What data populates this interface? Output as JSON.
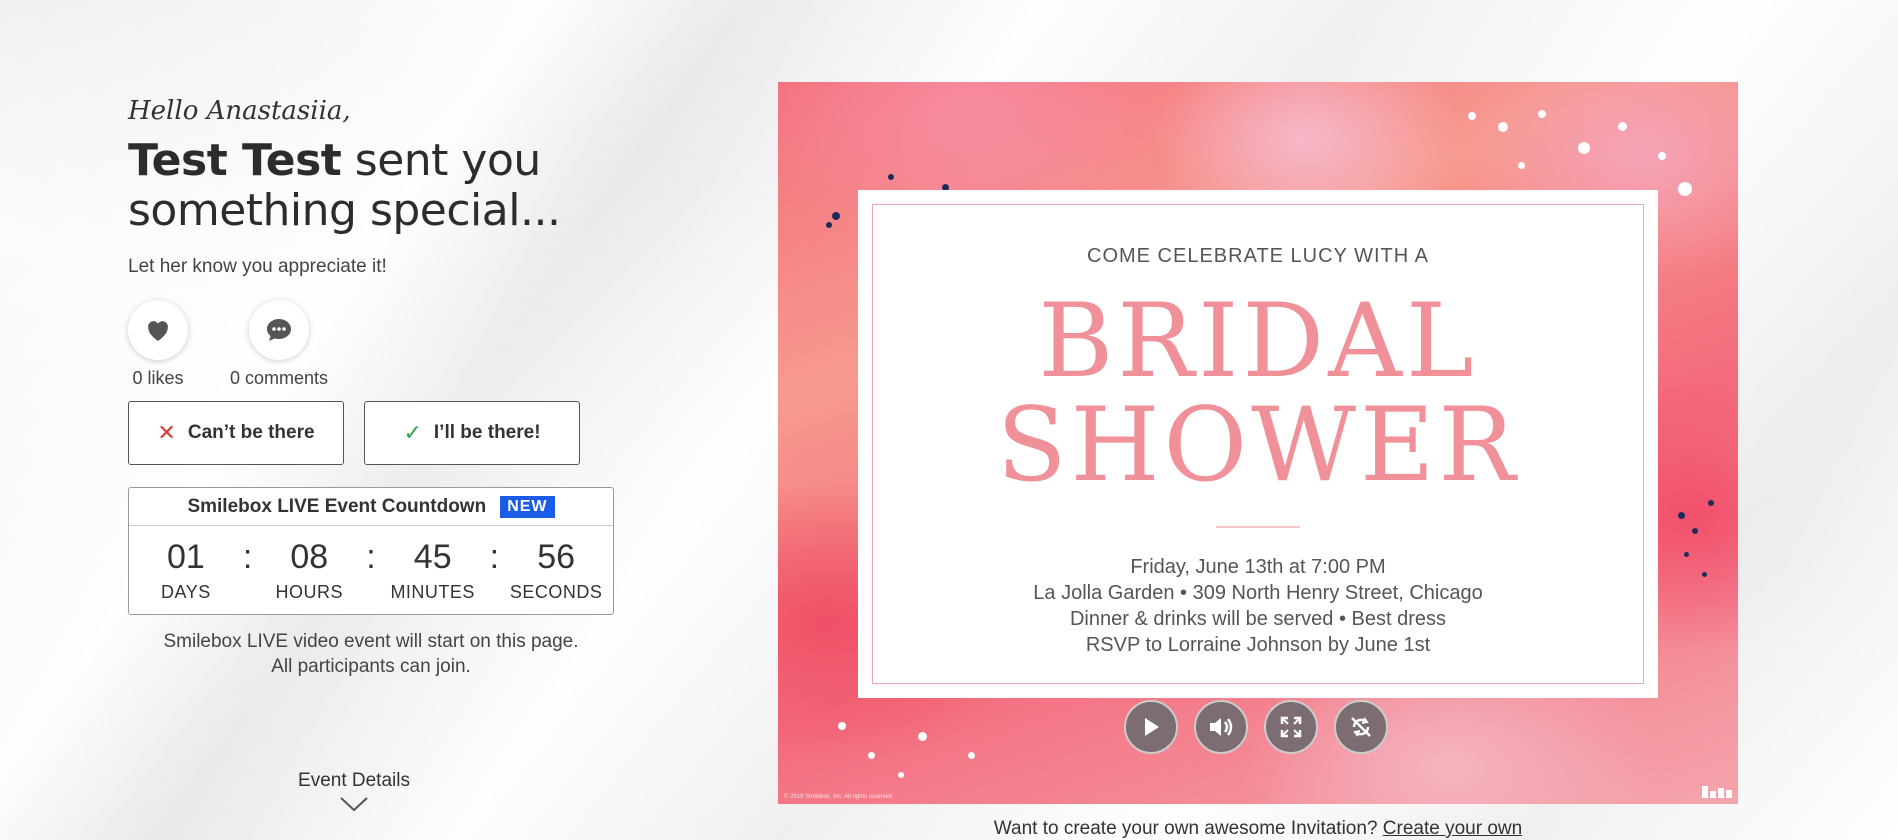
{
  "greeting": "Hello Anastasiia,",
  "headline": {
    "sender": "Test Test",
    "rest_line1": " sent you",
    "line2": "something special..."
  },
  "subline": "Let her know you appreciate it!",
  "reactions": {
    "likes_label": "0 likes",
    "comments_label": "0 comments"
  },
  "rsvp": {
    "decline_label": "Can’t be there",
    "accept_label": "I’ll be there!"
  },
  "countdown": {
    "title": "Smilebox LIVE Event Countdown",
    "badge": "NEW",
    "units": [
      {
        "value": "01",
        "label": "DAYS"
      },
      {
        "value": "08",
        "label": "HOURS"
      },
      {
        "value": "45",
        "label": "MINUTES"
      },
      {
        "value": "56",
        "label": "SECONDS"
      }
    ],
    "separator": ":"
  },
  "live_note": {
    "line1": "Smilebox LIVE video event will start on this page.",
    "line2": "All participants can join."
  },
  "event_details_label": "Event Details",
  "invitation": {
    "kicker": "COME CELEBRATE LUCY WITH A",
    "title_line1": "BRIDAL",
    "title_line2": "SHOWER",
    "info_lines": [
      "Friday, June 13th at 7:00 PM",
      "La Jolla Garden • 309 North Henry Street, Chicago",
      "Dinner & drinks will be served • Best dress",
      "RSVP to Lorraine Johnson by June 1st"
    ],
    "copyright": "© 2019 Smilebox, Inc. All rights reserved"
  },
  "cta": {
    "text": "Want to create your own awesome Invitation? ",
    "link": "Create your own"
  },
  "colors": {
    "accent_pink": "#f09199",
    "badge_blue": "#1a5ce6",
    "decline_red": "#e03636",
    "accept_green": "#2aa84a"
  }
}
